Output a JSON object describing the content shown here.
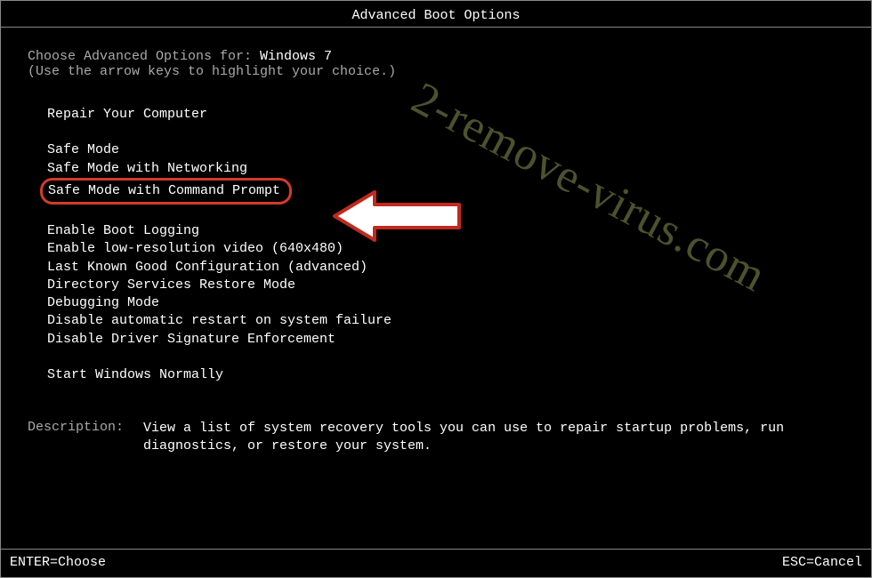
{
  "title": "Advanced Boot Options",
  "choose_prefix": "Choose Advanced Options for: ",
  "os_name": "Windows 7",
  "hint": "(Use the arrow keys to highlight your choice.)",
  "menu": {
    "repair": "Repair Your Computer",
    "safe_mode": "Safe Mode",
    "safe_mode_net": "Safe Mode with Networking",
    "safe_mode_cmd": "Safe Mode with Command Prompt",
    "boot_logging": "Enable Boot Logging",
    "low_res": "Enable low-resolution video (640x480)",
    "last_known": "Last Known Good Configuration (advanced)",
    "ds_restore": "Directory Services Restore Mode",
    "debugging": "Debugging Mode",
    "disable_restart": "Disable automatic restart on system failure",
    "disable_sig": "Disable Driver Signature Enforcement",
    "start_normal": "Start Windows Normally"
  },
  "description": {
    "label": "Description:",
    "text": "View a list of system recovery tools you can use to repair startup problems, run diagnostics, or restore your system."
  },
  "footer": {
    "enter": "ENTER=Choose",
    "esc": "ESC=Cancel"
  },
  "watermark": "2-remove-virus.com"
}
